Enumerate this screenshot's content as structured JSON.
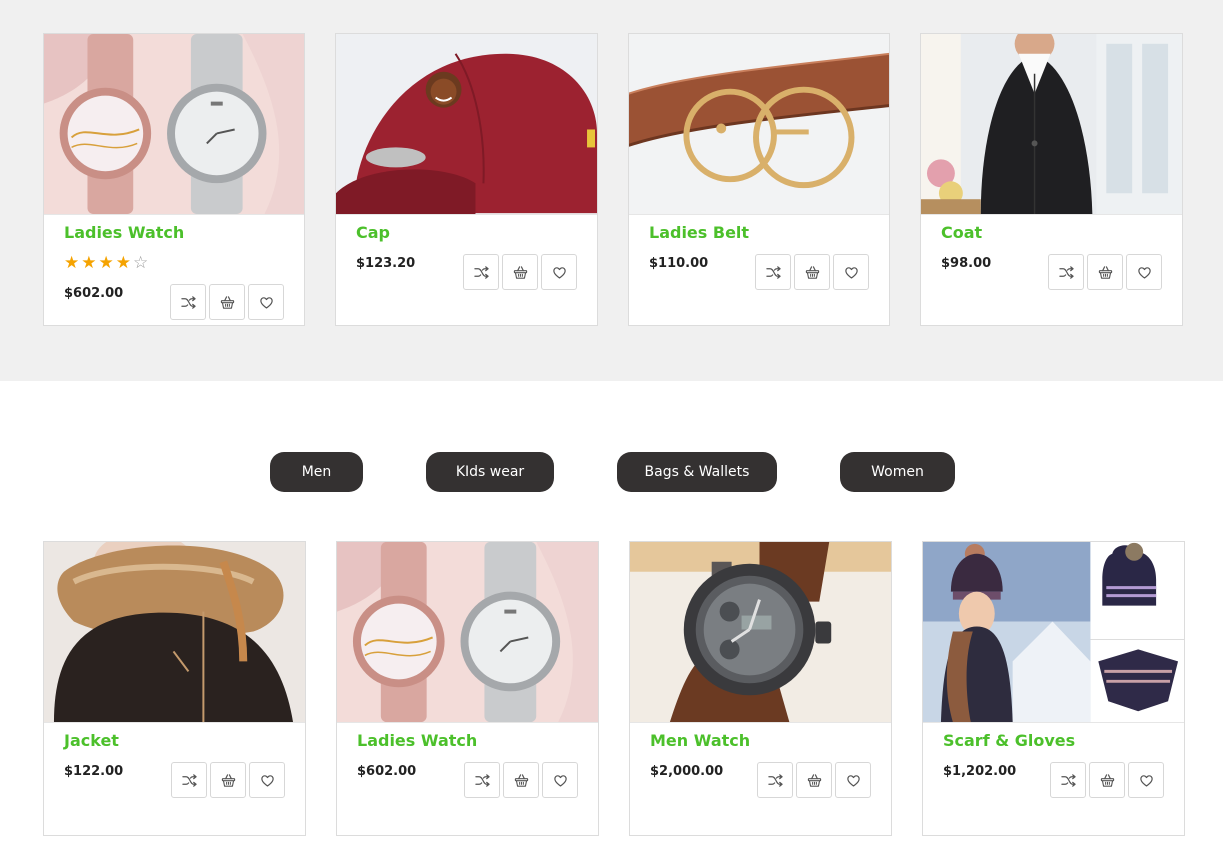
{
  "top_row": {
    "products": [
      {
        "title": "Ladies Watch",
        "price": "$602.00",
        "rating": 4,
        "rating_max": 5,
        "image": "ladies-watch-image"
      },
      {
        "title": "Cap",
        "price": "$123.20",
        "image": "cap-image"
      },
      {
        "title": "Ladies Belt",
        "price": "$110.00",
        "image": "ladies-belt-image"
      },
      {
        "title": "Coat",
        "price": "$98.00",
        "image": "coat-image"
      }
    ]
  },
  "filters": [
    "Men",
    "KIds wear",
    "Bags & Wallets",
    "Women"
  ],
  "bottom_row": {
    "products": [
      {
        "title": "Jacket",
        "price": "$122.00",
        "image": "jacket-image"
      },
      {
        "title": "Ladies Watch",
        "price": "$602.00",
        "image": "ladies-watch-image"
      },
      {
        "title": "Men Watch",
        "price": "$2,000.00",
        "image": "men-watch-image"
      },
      {
        "title": "Scarf & Gloves",
        "price": "$1,202.00",
        "image": "scarf-gloves-image"
      }
    ]
  },
  "actions": [
    "shuffle-icon",
    "basket-icon",
    "heart-icon"
  ],
  "colors": {
    "title": "#4cc02b",
    "pill_bg": "#343131",
    "star": "#f5a300",
    "top_band_bg": "#f0f0f0"
  }
}
